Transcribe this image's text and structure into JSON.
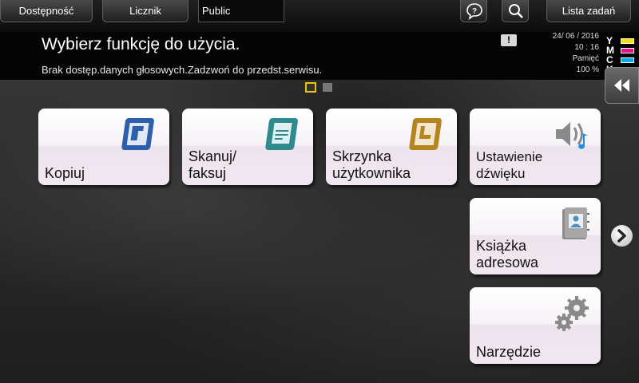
{
  "topbar": {
    "accessibility_label": "Dostępność",
    "counter_label": "Licznik",
    "user_field_value": "Public",
    "job_list_label": "Lista zadań"
  },
  "message": {
    "main": "Wybierz funkcję do użycia.",
    "sub": "Brak dostęp.danych głosowych.Zadzwoń do przedst.serwisu.",
    "warning_symbol": "!"
  },
  "status": {
    "date": "24/ 06 / 2016",
    "time": "10 : 16",
    "memory_label": "Pamięć",
    "memory_value": "100 %"
  },
  "toner": [
    {
      "letter": "Y",
      "color": "#ffe000"
    },
    {
      "letter": "M",
      "color": "#e0148c"
    },
    {
      "letter": "C",
      "color": "#00a8e8"
    },
    {
      "letter": "K",
      "color": "#111111"
    }
  ],
  "pagination": {
    "current": 1,
    "total": 2
  },
  "tiles": {
    "copy": {
      "label": "Kopiuj",
      "icon": "copy-icon",
      "color": "#2d5fae"
    },
    "scan_fax": {
      "line1": "Skanuj/",
      "line2": "faksuj",
      "icon": "scan-fax-icon",
      "color": "#2e8a8e"
    },
    "user_box": {
      "line1": "Skrzynka",
      "line2": "użytkownika",
      "icon": "user-box-icon",
      "color": "#b38420"
    },
    "sound": {
      "line1": "Ustawienie",
      "line2": "dźwięku",
      "icon": "speaker-icon"
    },
    "address_book": {
      "line1": "Książka",
      "line2": "adresowa",
      "icon": "address-book-icon"
    },
    "utility": {
      "label": "Narzędzie",
      "icon": "gears-icon"
    }
  }
}
